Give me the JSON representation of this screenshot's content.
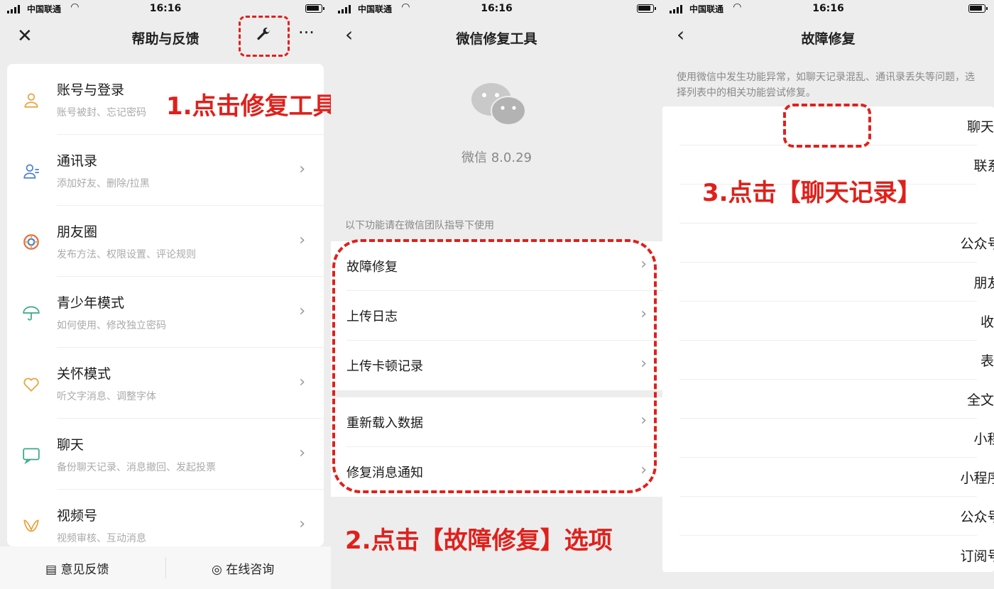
{
  "status": {
    "carrier": "中国联通",
    "time": "16:16"
  },
  "screen1": {
    "title": "帮助与反馈",
    "items": [
      {
        "title": "账号与登录",
        "subtitle": "账号被封、忘记密码"
      },
      {
        "title": "通讯录",
        "subtitle": "添加好友、删除/拉黑"
      },
      {
        "title": "朋友圈",
        "subtitle": "发布方法、权限设置、评论规则"
      },
      {
        "title": "青少年模式",
        "subtitle": "如何使用、修改独立密码"
      },
      {
        "title": "关怀模式",
        "subtitle": "听文字消息、调整字体"
      },
      {
        "title": "聊天",
        "subtitle": "备份聊天记录、消息撤回、发起投票"
      },
      {
        "title": "视频号",
        "subtitle": "视频审核、互动消息"
      }
    ],
    "bottom": {
      "feedback": "意见反馈",
      "consult": "在线咨询"
    },
    "annotation": "1.点击修复工具图标"
  },
  "screen2": {
    "title": "微信修复工具",
    "version": "微信 8.0.29",
    "hint": "以下功能请在微信团队指导下使用",
    "group1": [
      "故障修复",
      "上传日志",
      "上传卡顿记录"
    ],
    "group2": [
      "重新载入数据",
      "修复消息通知"
    ],
    "annotation": "2.点击【故障修复】选项"
  },
  "screen3": {
    "title": "故障修复",
    "desc": "使用微信中发生功能异常，如聊天记录混乱、通讯录丢失等问题，选择列表中的相关功能尝试修复。",
    "items": [
      "聊天记录",
      "联系人",
      "公众号消息",
      "朋友圈",
      "收藏",
      "表情",
      "全文搜索",
      "小程序",
      "小程序会话",
      "公众号会话",
      "订阅号消息"
    ],
    "annotation": "3.点击【聊天记录】"
  },
  "colors": {
    "accent": "#e0201b",
    "icon_orange": "#e8a33d",
    "icon_blue": "#4a7fd6"
  }
}
